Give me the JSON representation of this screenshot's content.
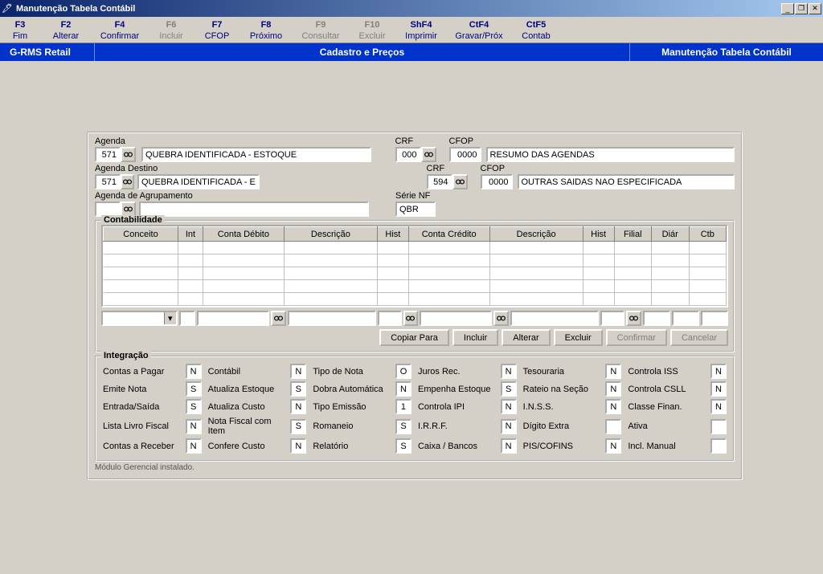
{
  "window": {
    "title": "Manutenção Tabela Contábil"
  },
  "fkeys": [
    {
      "key": "F3",
      "label": "Fim",
      "disabled": false
    },
    {
      "key": "F2",
      "label": "Alterar",
      "disabled": false
    },
    {
      "key": "F4",
      "label": "Confirmar",
      "disabled": false
    },
    {
      "key": "F6",
      "label": "Incluir",
      "disabled": true
    },
    {
      "key": "F7",
      "label": "CFOP",
      "disabled": false
    },
    {
      "key": "F8",
      "label": "Próximo",
      "disabled": false
    },
    {
      "key": "F9",
      "label": "Consultar",
      "disabled": true
    },
    {
      "key": "F10",
      "label": "Excluir",
      "disabled": true
    },
    {
      "key": "ShF4",
      "label": "Imprimir",
      "disabled": false
    },
    {
      "key": "CtF4",
      "label": "Gravar/Próx",
      "disabled": false
    },
    {
      "key": "CtF5",
      "label": "Contab",
      "disabled": false
    }
  ],
  "header": {
    "left": "G-RMS Retail",
    "center": "Cadastro e Preços",
    "right": "Manutenção Tabela Contábil"
  },
  "form": {
    "agenda": {
      "label": "Agenda",
      "code": "571",
      "desc": "QUEBRA IDENTIFICADA - ESTOQUE"
    },
    "crf1": {
      "label": "CRF",
      "value": "000"
    },
    "cfop1": {
      "label": "CFOP",
      "code": "0000",
      "desc": "RESUMO DAS AGENDAS"
    },
    "agendaDest": {
      "label": "Agenda Destino",
      "code": "571",
      "desc": "QUEBRA IDENTIFICADA - ESTOQUE"
    },
    "crf2": {
      "label": "CRF",
      "value": "594"
    },
    "cfop2": {
      "label": "CFOP",
      "code": "0000",
      "desc": "OUTRAS SAIDAS NAO ESPECIFICADA"
    },
    "agendaAgrup": {
      "label": "Agenda de Agrupamento",
      "code": "",
      "desc": ""
    },
    "serieNF": {
      "label": "Série NF",
      "value": "QBR"
    }
  },
  "contabilidade": {
    "legend": "Contabilidade",
    "columns": [
      "Conceito",
      "Int",
      "Conta Débito",
      "Descrição",
      "Hist",
      "Conta Crédito",
      "Descrição",
      "Hist",
      "Filial",
      "Diár",
      "Ctb"
    ],
    "buttons": {
      "copiar": "Copiar Para",
      "incluir": "Incluir",
      "alterar": "Alterar",
      "excluir": "Excluir",
      "confirmar": "Confirmar",
      "cancelar": "Cancelar"
    }
  },
  "integracao": {
    "legend": "Integração",
    "items": [
      [
        {
          "l": "Contas a Pagar",
          "v": "N"
        },
        {
          "l": "Contábil",
          "v": "N"
        },
        {
          "l": "Tipo de Nota",
          "v": "O"
        },
        {
          "l": "Juros Rec.",
          "v": "N"
        },
        {
          "l": "Tesouraria",
          "v": "N"
        },
        {
          "l": "Controla ISS",
          "v": "N"
        }
      ],
      [
        {
          "l": "Emite Nota",
          "v": "S"
        },
        {
          "l": "Atualiza Estoque",
          "v": "S"
        },
        {
          "l": "Dobra Automática",
          "v": "N"
        },
        {
          "l": "Empenha Estoque",
          "v": "S"
        },
        {
          "l": "Rateio na Seção",
          "v": "N"
        },
        {
          "l": "Controla CSLL",
          "v": "N"
        }
      ],
      [
        {
          "l": "Entrada/Saída",
          "v": "S"
        },
        {
          "l": "Atualiza Custo",
          "v": "N"
        },
        {
          "l": "Tipo Emissão",
          "v": "1"
        },
        {
          "l": "Controla IPI",
          "v": "N"
        },
        {
          "l": "I.N.S.S.",
          "v": "N"
        },
        {
          "l": "Classe Finan.",
          "v": "N"
        }
      ],
      [
        {
          "l": "Lista Livro Fiscal",
          "v": "N"
        },
        {
          "l": "Nota Fiscal com Item",
          "v": "S"
        },
        {
          "l": "Romaneio",
          "v": "S"
        },
        {
          "l": "I.R.R.F.",
          "v": "N"
        },
        {
          "l": "Dígito Extra",
          "v": ""
        },
        {
          "l": "Ativa",
          "v": ""
        }
      ],
      [
        {
          "l": "Contas a Receber",
          "v": "N"
        },
        {
          "l": "Confere Custo",
          "v": "N"
        },
        {
          "l": "Relatório",
          "v": "S"
        },
        {
          "l": "Caixa / Bancos",
          "v": "N"
        },
        {
          "l": "PIS/COFINS",
          "v": "N"
        },
        {
          "l": "Incl. Manual",
          "v": ""
        }
      ]
    ]
  },
  "status": "Módulo Gerencial instalado."
}
